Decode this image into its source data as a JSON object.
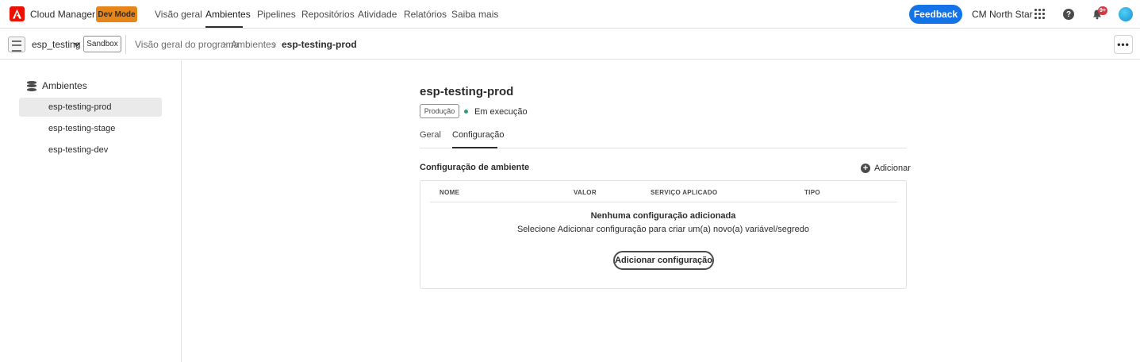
{
  "topnav": {
    "app_name": "Cloud Manager",
    "dev_mode": "Dev Mode",
    "items": [
      "Visão geral",
      "Ambientes",
      "Pipelines",
      "Repositórios",
      "Atividade",
      "Relatórios",
      "Saiba mais"
    ],
    "active_item": "Ambientes",
    "feedback": "Feedback",
    "org": "CM North Star",
    "notifications": "9+",
    "help": "?",
    "brand_color": "#eb1000",
    "accent_color": "#1473e6"
  },
  "subbar": {
    "program": "esp_testing",
    "sandbox": "Sandbox",
    "breadcrumb": [
      "Visão geral do programa",
      "Ambientes",
      "esp-testing-prod"
    ],
    "more": "•••"
  },
  "sidebar": {
    "heading": "Ambientes",
    "items": [
      "esp-testing-prod",
      "esp-testing-stage",
      "esp-testing-dev"
    ],
    "active": "esp-testing-prod"
  },
  "main": {
    "title": "esp-testing-prod",
    "tag": "Produção",
    "status": "Em execução",
    "status_color": "#2d9d78",
    "tabs": [
      "Geral",
      "Configuração"
    ],
    "active_tab": "Configuração",
    "section_title": "Configuração de ambiente",
    "add_label": "Adicionar",
    "columns": [
      "NOME",
      "VALOR",
      "SERVIÇO APLICADO",
      "TIPO"
    ],
    "empty_title": "Nenhuma configuração adicionada",
    "empty_desc": "Selecione Adicionar configuração para criar um(a) novo(a) variável/segredo",
    "add_config_button": "Adicionar configuração"
  }
}
